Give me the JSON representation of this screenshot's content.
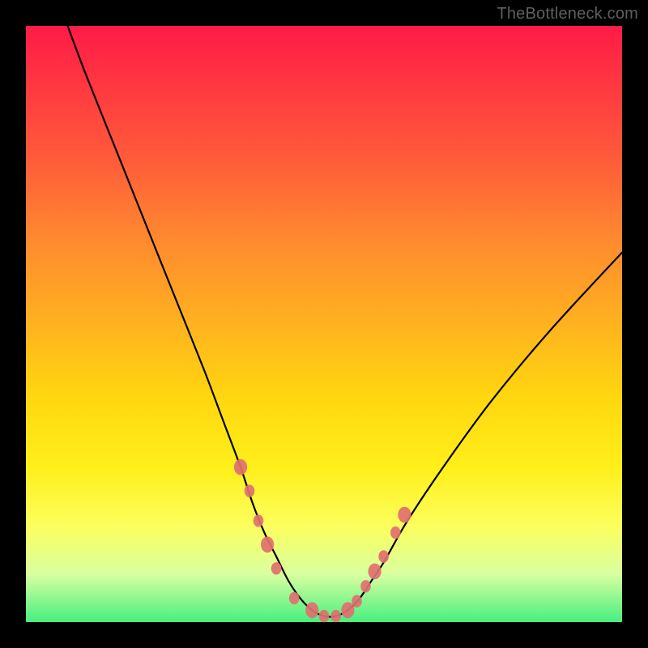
{
  "watermark": "TheBottleneck.com",
  "chart_data": {
    "type": "line",
    "title": "",
    "xlabel": "",
    "ylabel": "",
    "xlim": [
      0,
      100
    ],
    "ylim": [
      0,
      100
    ],
    "series": [
      {
        "name": "curve",
        "x": [
          7,
          10,
          14,
          18,
          22,
          26,
          30,
          33,
          36,
          38,
          40,
          42,
          44,
          46,
          48,
          50,
          52,
          54,
          56,
          58,
          60,
          64,
          70,
          78,
          88,
          100
        ],
        "y": [
          100,
          92,
          82,
          72,
          62,
          52,
          42,
          34,
          26,
          20,
          15,
          11,
          7,
          4,
          2,
          1,
          1,
          2,
          4,
          7,
          10,
          17,
          26,
          37,
          49,
          62
        ]
      }
    ],
    "markers": {
      "name": "red-dots",
      "color": "#e07070",
      "x": [
        36,
        37.5,
        39,
        40.5,
        42,
        45,
        48,
        50,
        52,
        54,
        55.5,
        57,
        58.5,
        60,
        62,
        63.5
      ],
      "y": [
        26,
        22,
        17,
        13,
        9,
        4,
        2,
        1,
        1,
        2,
        3.5,
        6,
        8.5,
        11,
        15,
        18
      ]
    }
  }
}
